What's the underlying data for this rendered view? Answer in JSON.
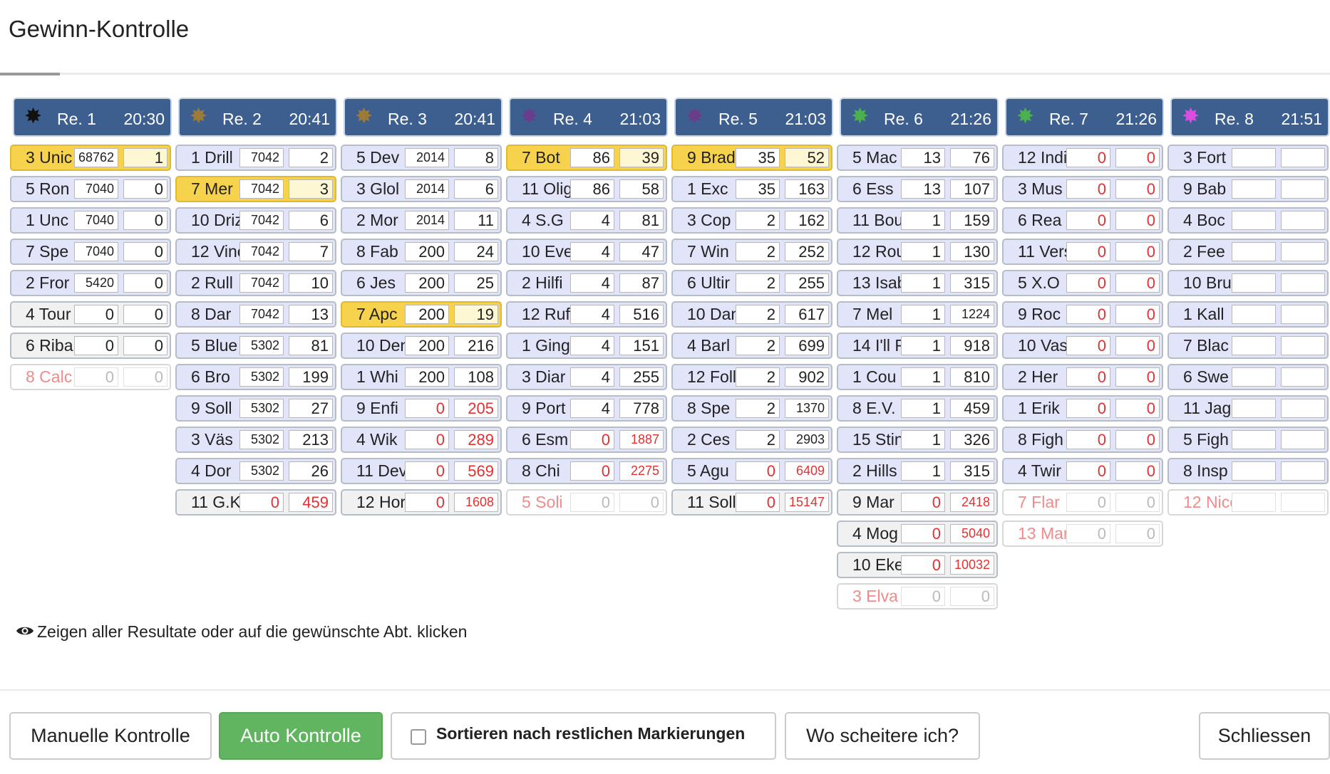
{
  "title": "Gewinn-Kontrolle",
  "colors": {
    "header_bg": "#3d5f8f",
    "row_bg": "#e2e5fa",
    "highlight": "#f7d24d",
    "red": "#e53030",
    "green": "#62b560"
  },
  "races": [
    {
      "label": "Re. 1",
      "time": "20:30",
      "star_color": "#111111",
      "rows": [
        {
          "name": "3 Unic",
          "v1": "68762",
          "v2": "1",
          "hl": true
        },
        {
          "name": "5 Ron",
          "v1": "7040",
          "v2": "0"
        },
        {
          "name": "1 Unc",
          "v1": "7040",
          "v2": "0"
        },
        {
          "name": "7 Spe",
          "v1": "7040",
          "v2": "0"
        },
        {
          "name": "2 Fror",
          "v1": "5420",
          "v2": "0"
        },
        {
          "name": "4 Tour",
          "v1": "0",
          "v2": "0",
          "gray": true
        },
        {
          "name": "6 Riba",
          "v1": "0",
          "v2": "0",
          "gray": true
        },
        {
          "name": "8 Calc",
          "v1": "0",
          "v2": "0",
          "faded": true
        }
      ]
    },
    {
      "label": "Re. 2",
      "time": "20:41",
      "star_color": "#9b7a3a",
      "rows": [
        {
          "name": "1 Drill",
          "v1": "7042",
          "v2": "2"
        },
        {
          "name": "7 Mer",
          "v1": "7042",
          "v2": "3",
          "hl": true
        },
        {
          "name": "10 Driz",
          "v1": "7042",
          "v2": "6"
        },
        {
          "name": "12 Vinc",
          "v1": "7042",
          "v2": "7"
        },
        {
          "name": "2 Rull",
          "v1": "7042",
          "v2": "10"
        },
        {
          "name": "8 Dar",
          "v1": "7042",
          "v2": "13"
        },
        {
          "name": "5 Blue",
          "v1": "5302",
          "v2": "81"
        },
        {
          "name": "6 Bro",
          "v1": "5302",
          "v2": "199"
        },
        {
          "name": "9 Soll",
          "v1": "5302",
          "v2": "27"
        },
        {
          "name": "3 Väs",
          "v1": "5302",
          "v2": "213"
        },
        {
          "name": "4 Dor",
          "v1": "5302",
          "v2": "26"
        },
        {
          "name": "11 G.K",
          "v1": "0",
          "v2": "459",
          "red": true,
          "gray": true
        }
      ]
    },
    {
      "label": "Re. 3",
      "time": "20:41",
      "star_color": "#9b7a3a",
      "rows": [
        {
          "name": "5 Dev",
          "v1": "2014",
          "v2": "8"
        },
        {
          "name": "3 Glol",
          "v1": "2014",
          "v2": "6"
        },
        {
          "name": "2 Mor",
          "v1": "2014",
          "v2": "11"
        },
        {
          "name": "8 Fab",
          "v1": "200",
          "v2": "24"
        },
        {
          "name": "6 Jes",
          "v1": "200",
          "v2": "25"
        },
        {
          "name": "7 Apc",
          "v1": "200",
          "v2": "19",
          "hl": true
        },
        {
          "name": "10 Den",
          "v1": "200",
          "v2": "216"
        },
        {
          "name": "1 Whi",
          "v1": "200",
          "v2": "108"
        },
        {
          "name": "9 Enfi",
          "v1": "0",
          "v2": "205",
          "red": true
        },
        {
          "name": "4 Wik",
          "v1": "0",
          "v2": "289",
          "red": true
        },
        {
          "name": "11 Dev",
          "v1": "0",
          "v2": "569",
          "red": true
        },
        {
          "name": "12 Hor",
          "v1": "0",
          "v2": "1608",
          "red": true,
          "gray": true
        }
      ]
    },
    {
      "label": "Re. 4",
      "time": "21:03",
      "star_color": "#6a3c8c",
      "rows": [
        {
          "name": "7 Bot",
          "v1": "86",
          "v2": "39",
          "hl": true
        },
        {
          "name": "11 Olig",
          "v1": "86",
          "v2": "58"
        },
        {
          "name": "4 S.G",
          "v1": "4",
          "v2": "81"
        },
        {
          "name": "10 Eve",
          "v1": "4",
          "v2": "47"
        },
        {
          "name": "2 Hilfi",
          "v1": "4",
          "v2": "87"
        },
        {
          "name": "12 Ruff",
          "v1": "4",
          "v2": "516"
        },
        {
          "name": "1 Ging",
          "v1": "4",
          "v2": "151"
        },
        {
          "name": "3 Diar",
          "v1": "4",
          "v2": "255"
        },
        {
          "name": "9 Port",
          "v1": "4",
          "v2": "778"
        },
        {
          "name": "6 Esm",
          "v1": "0",
          "v2": "1887",
          "red": true
        },
        {
          "name": "8 Chi",
          "v1": "0",
          "v2": "2275",
          "red": true
        },
        {
          "name": "5 Soli",
          "v1": "0",
          "v2": "0",
          "faded": true
        }
      ]
    },
    {
      "label": "Re. 5",
      "time": "21:03",
      "star_color": "#6a3c8c",
      "rows": [
        {
          "name": "9 Brad",
          "v1": "35",
          "v2": "52",
          "hl": true
        },
        {
          "name": "1 Exc",
          "v1": "35",
          "v2": "163"
        },
        {
          "name": "3 Cop",
          "v1": "2",
          "v2": "162"
        },
        {
          "name": "7 Win",
          "v1": "2",
          "v2": "252"
        },
        {
          "name": "6 Ultir",
          "v1": "2",
          "v2": "255"
        },
        {
          "name": "10 Dan",
          "v1": "2",
          "v2": "617"
        },
        {
          "name": "4 Barl",
          "v1": "2",
          "v2": "699"
        },
        {
          "name": "12 Foll",
          "v1": "2",
          "v2": "902"
        },
        {
          "name": "8 Spe",
          "v1": "2",
          "v2": "1370"
        },
        {
          "name": "2 Ces",
          "v1": "2",
          "v2": "2903"
        },
        {
          "name": "5 Agu",
          "v1": "0",
          "v2": "6409",
          "red": true
        },
        {
          "name": "11 Soll",
          "v1": "0",
          "v2": "15147",
          "red": true,
          "gray": true
        }
      ]
    },
    {
      "label": "Re. 6",
      "time": "21:26",
      "star_color": "#4caf50",
      "rows": [
        {
          "name": "5 Mac",
          "v1": "13",
          "v2": "76"
        },
        {
          "name": "6 Ess",
          "v1": "13",
          "v2": "107"
        },
        {
          "name": "11 Bou",
          "v1": "1",
          "v2": "159"
        },
        {
          "name": "12 Rou",
          "v1": "1",
          "v2": "130"
        },
        {
          "name": "13 Isab",
          "v1": "1",
          "v2": "315"
        },
        {
          "name": "7 Mel",
          "v1": "1",
          "v2": "1224"
        },
        {
          "name": "14 I'll F",
          "v1": "1",
          "v2": "918"
        },
        {
          "name": "1 Cou",
          "v1": "1",
          "v2": "810"
        },
        {
          "name": "8 E.V.",
          "v1": "1",
          "v2": "459"
        },
        {
          "name": "15 Stin",
          "v1": "1",
          "v2": "326"
        },
        {
          "name": "2 Hills",
          "v1": "1",
          "v2": "315"
        },
        {
          "name": "9 Mar",
          "v1": "0",
          "v2": "2418",
          "red": true,
          "gray": true
        },
        {
          "name": "4 Mog",
          "v1": "0",
          "v2": "5040",
          "red": true,
          "gray": true
        },
        {
          "name": "10 Eke",
          "v1": "0",
          "v2": "10032",
          "red": true,
          "gray": true
        },
        {
          "name": "3 Elva",
          "v1": "0",
          "v2": "0",
          "faded": true
        }
      ]
    },
    {
      "label": "Re. 7",
      "time": "21:26",
      "star_color": "#4caf50",
      "rows": [
        {
          "name": "12 Indi",
          "v1": "0",
          "v2": "0",
          "red": true
        },
        {
          "name": "3 Mus",
          "v1": "0",
          "v2": "0",
          "red": true
        },
        {
          "name": "6 Rea",
          "v1": "0",
          "v2": "0",
          "red": true
        },
        {
          "name": "11 Vers",
          "v1": "0",
          "v2": "0",
          "red": true
        },
        {
          "name": "5 X.O",
          "v1": "0",
          "v2": "0",
          "red": true
        },
        {
          "name": "9 Roc",
          "v1": "0",
          "v2": "0",
          "red": true
        },
        {
          "name": "10 Vas",
          "v1": "0",
          "v2": "0",
          "red": true
        },
        {
          "name": "2 Her",
          "v1": "0",
          "v2": "0",
          "red": true
        },
        {
          "name": "1 Erik",
          "v1": "0",
          "v2": "0",
          "red": true
        },
        {
          "name": "8 Figh",
          "v1": "0",
          "v2": "0",
          "red": true
        },
        {
          "name": "4 Twir",
          "v1": "0",
          "v2": "0",
          "red": true
        },
        {
          "name": "7 Flar",
          "v1": "0",
          "v2": "0",
          "faded": true
        },
        {
          "name": "13 Mar",
          "v1": "0",
          "v2": "0",
          "faded": true
        }
      ]
    },
    {
      "label": "Re. 8",
      "time": "21:51",
      "star_color": "#d94ee0",
      "rows": [
        {
          "name": "3 Fort",
          "v1": "",
          "v2": ""
        },
        {
          "name": "9 Bab",
          "v1": "",
          "v2": ""
        },
        {
          "name": "4 Boc",
          "v1": "",
          "v2": ""
        },
        {
          "name": "2 Fee",
          "v1": "",
          "v2": ""
        },
        {
          "name": "10 Brui",
          "v1": "",
          "v2": ""
        },
        {
          "name": "1 Kall",
          "v1": "",
          "v2": ""
        },
        {
          "name": "7 Blac",
          "v1": "",
          "v2": ""
        },
        {
          "name": "6 Swe",
          "v1": "",
          "v2": ""
        },
        {
          "name": "11 Jag",
          "v1": "",
          "v2": ""
        },
        {
          "name": "5 Figh",
          "v1": "",
          "v2": ""
        },
        {
          "name": "8 Insp",
          "v1": "",
          "v2": ""
        },
        {
          "name": "12 Nice",
          "v1": "",
          "v2": "",
          "faded": true
        }
      ]
    }
  ],
  "info_text": "Zeigen aller Resultate oder auf die gewünschte Abt. klicken",
  "buttons": {
    "manual": "Manuelle Kontrolle",
    "auto": "Auto Kontrolle",
    "sort_label": "Sortieren nach restlichen Markierungen",
    "fail": "Wo scheitere ich?",
    "close": "Schliessen"
  }
}
